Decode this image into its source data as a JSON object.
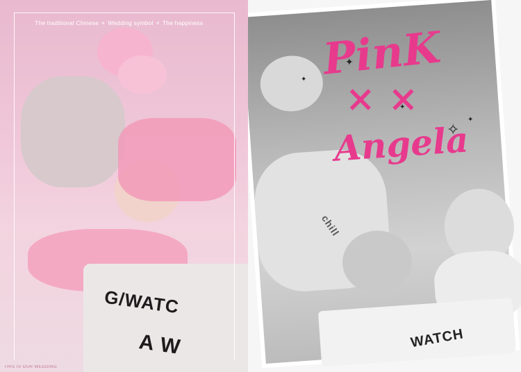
{
  "left_panel": {
    "tagline": {
      "part1": "The traditional Chinese",
      "sep1": "×",
      "part2": "Wedding symbol",
      "sep2": "×",
      "part3": "The happiness"
    },
    "mat_text_1": "G/WATC",
    "mat_text_2": "A W",
    "border_text": "THIS IS OUR WEDDING"
  },
  "right_panel": {
    "title_line1": "PinK",
    "title_cross": "×  ×",
    "title_line2": "Angela",
    "mat_text": "WATCH",
    "shirt_text": "chill"
  },
  "colors": {
    "title_pink": "#e73a8d",
    "left_bg": "#efc6d8",
    "right_bg": "#f6f6f6"
  }
}
